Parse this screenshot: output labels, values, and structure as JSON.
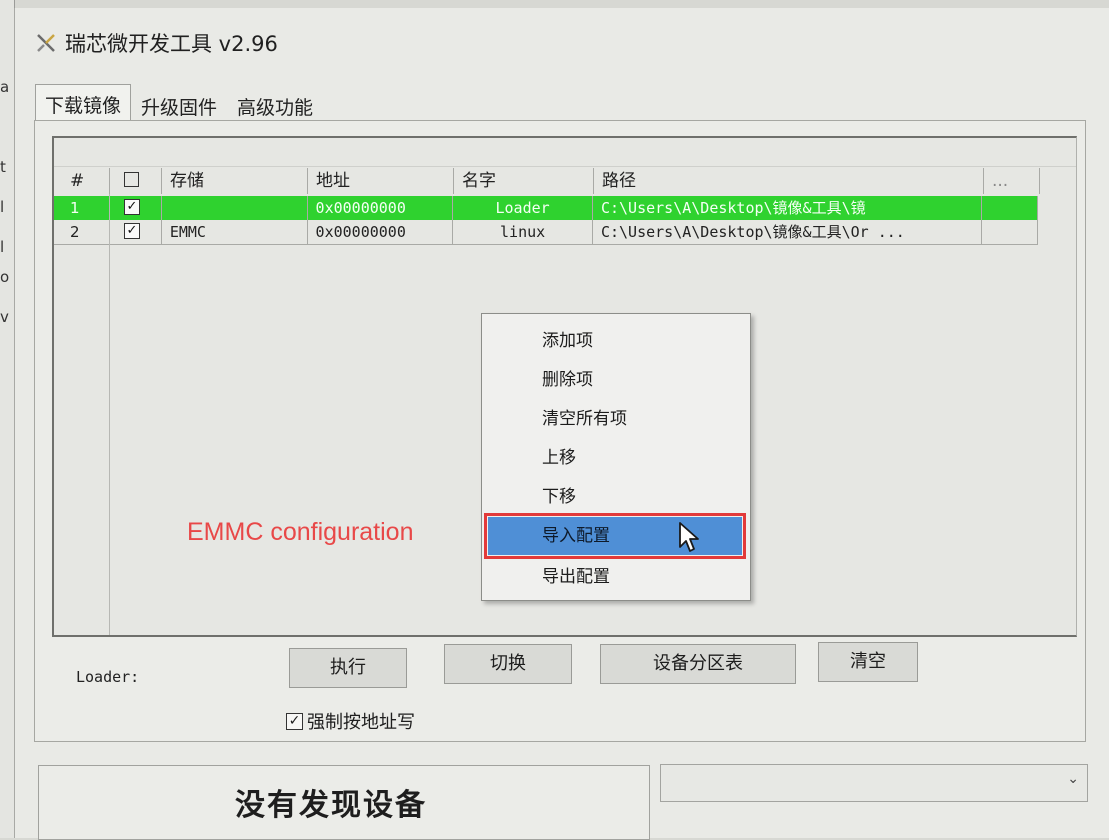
{
  "window": {
    "title": "瑞芯微开发工具 v2.96"
  },
  "tabs": [
    {
      "label": "下载镜像",
      "active": true
    },
    {
      "label": "升级固件",
      "active": false
    },
    {
      "label": "高级功能",
      "active": false
    }
  ],
  "table": {
    "columns": [
      "#",
      "",
      "存储",
      "地址",
      "名字",
      "路径",
      "..."
    ],
    "rows": [
      {
        "num": "1",
        "checked": true,
        "storage": "",
        "address": "0x00000000",
        "name": "Loader",
        "path": "C:\\Users\\A\\Desktop\\镜像&工具\\镜",
        "selected": true
      },
      {
        "num": "2",
        "checked": true,
        "storage": "EMMC",
        "address": "0x00000000",
        "name": "linux",
        "path": "C:\\Users\\A\\Desktop\\镜像&工具\\Or ...",
        "selected": false
      }
    ],
    "selected_color": "#2fd22f"
  },
  "context_menu": {
    "items": [
      "添加项",
      "删除项",
      "清空所有项",
      "上移",
      "下移",
      "导入配置",
      "导出配置"
    ],
    "highlighted": "导入配置",
    "highlight_color": "#4f8fd6"
  },
  "annotation": {
    "text": "EMMC configuration",
    "color": "#e84848"
  },
  "bottom": {
    "loader_label": "Loader:",
    "buttons": [
      "执行",
      "切换",
      "设备分区表",
      "清空"
    ],
    "force_address_write": {
      "label": "强制按地址写",
      "checked": true
    }
  },
  "status": {
    "text": "没有发现设备"
  },
  "device_select": {
    "value": ""
  }
}
